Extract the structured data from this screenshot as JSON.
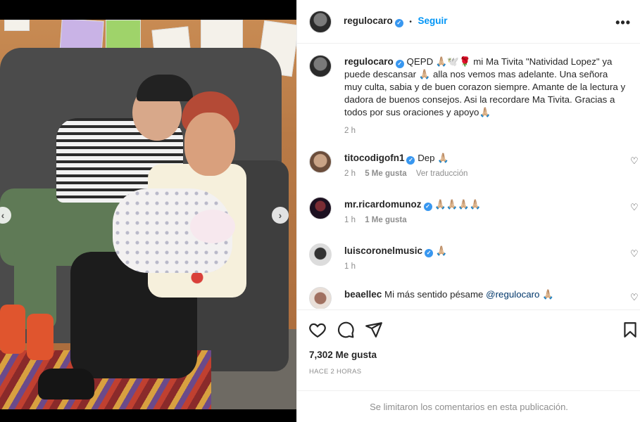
{
  "post": {
    "author": "regulocaro",
    "follow_label": "Seguir",
    "separator": "•",
    "more_label": "•••",
    "photo": {
      "slide_count": 5,
      "active_slide": 3
    },
    "caption": {
      "username": "regulocaro",
      "text": "QEPD 🙏🏼🕊️🌹 mi Ma Tivita \"Natividad Lopez\" ya puede descansar 🙏🏼 alla nos vemos mas adelante. Una señora muy culta, sabia y de buen corazon siempre. Amante de la lectura y dadora de buenos consejos. Asi la recordare Ma Tivita. Gracias a todos por sus oraciones y apoyo🙏🏼",
      "time": "2 h"
    },
    "comments": [
      {
        "username": "titocodigofn1",
        "verified": true,
        "text": "Dep 🙏🏼",
        "time": "2 h",
        "likes": "5 Me gusta",
        "translate": "Ver traducción",
        "avatar": "a-tito"
      },
      {
        "username": "mr.ricardomunoz",
        "verified": true,
        "text": "🙏🏼🙏🏼🙏🏼🙏🏼",
        "time": "1 h",
        "likes": "1 Me gusta",
        "translate": "",
        "avatar": "a-ricardo"
      },
      {
        "username": "luiscoronelmusic",
        "verified": true,
        "text": "🙏🏼",
        "time": "1 h",
        "likes": "",
        "translate": "",
        "avatar": "a-luis"
      },
      {
        "username": "beaellec",
        "verified": false,
        "text": "Mi más sentido pésame",
        "mention": "@regulocaro",
        "text_after": " 🙏🏼",
        "time": "",
        "likes": "",
        "translate": "",
        "avatar": "a-bea"
      }
    ],
    "likes_count": "7,302 Me gusta",
    "posted_ago": "HACE 2 HORAS",
    "comments_disabled_notice": "Se limitaron los comentarios en esta publicación."
  },
  "colors": {
    "link": "#0095f6",
    "verified": "#3897f0",
    "muted": "#8e8e8e",
    "text": "#262626"
  },
  "icons": [
    "heart-icon",
    "comment-icon",
    "share-icon",
    "bookmark-icon",
    "verified-icon",
    "more-icon",
    "chevron-left-icon",
    "chevron-right-icon"
  ]
}
